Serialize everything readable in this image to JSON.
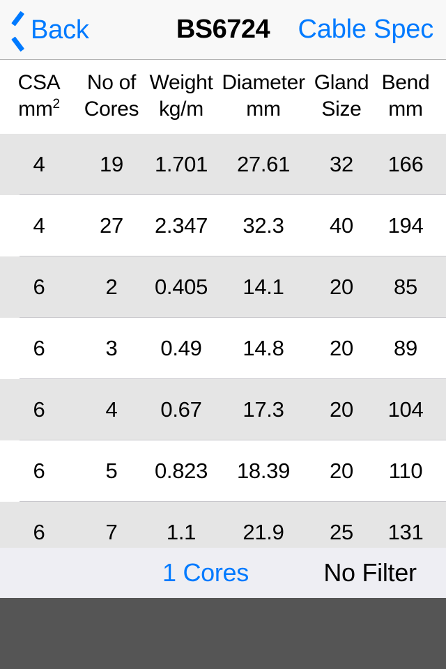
{
  "navbar": {
    "back_label": "Back",
    "title": "BS6724",
    "right_label": "Cable Spec",
    "accent_color": "#007aff",
    "background_color": "#f8f8f8"
  },
  "table": {
    "columns": [
      {
        "line1": "CSA",
        "line2": "mm",
        "unit_sup": "2"
      },
      {
        "line1": "No of",
        "line2": "Cores",
        "unit_sup": ""
      },
      {
        "line1": "Weight",
        "line2": "kg/m",
        "unit_sup": ""
      },
      {
        "line1": "Diameter",
        "line2": "mm",
        "unit_sup": ""
      },
      {
        "line1": "Gland",
        "line2": "Size",
        "unit_sup": ""
      },
      {
        "line1": "Bend",
        "line2": "mm",
        "unit_sup": ""
      }
    ],
    "rows": [
      {
        "csa": "4",
        "cores": "19",
        "weight": "1.701",
        "diameter": "27.61",
        "gland": "32",
        "bend": "166"
      },
      {
        "csa": "4",
        "cores": "27",
        "weight": "2.347",
        "diameter": "32.3",
        "gland": "40",
        "bend": "194"
      },
      {
        "csa": "6",
        "cores": "2",
        "weight": "0.405",
        "diameter": "14.1",
        "gland": "20",
        "bend": "85"
      },
      {
        "csa": "6",
        "cores": "3",
        "weight": "0.49",
        "diameter": "14.8",
        "gland": "20",
        "bend": "89"
      },
      {
        "csa": "6",
        "cores": "4",
        "weight": "0.67",
        "diameter": "17.3",
        "gland": "20",
        "bend": "104"
      },
      {
        "csa": "6",
        "cores": "5",
        "weight": "0.823",
        "diameter": "18.39",
        "gland": "20",
        "bend": "110"
      },
      {
        "csa": "6",
        "cores": "7",
        "weight": "1.1",
        "diameter": "21.9",
        "gland": "25",
        "bend": "131"
      }
    ],
    "row_colors": {
      "odd": "#e5e5e5",
      "even": "#ffffff",
      "separator": "#c8c7cc"
    }
  },
  "toolbar": {
    "cores_label": "1 Cores",
    "filter_label": "No Filter",
    "background_color": "#eeeef3"
  },
  "bottom_area": {
    "color": "#555555"
  }
}
